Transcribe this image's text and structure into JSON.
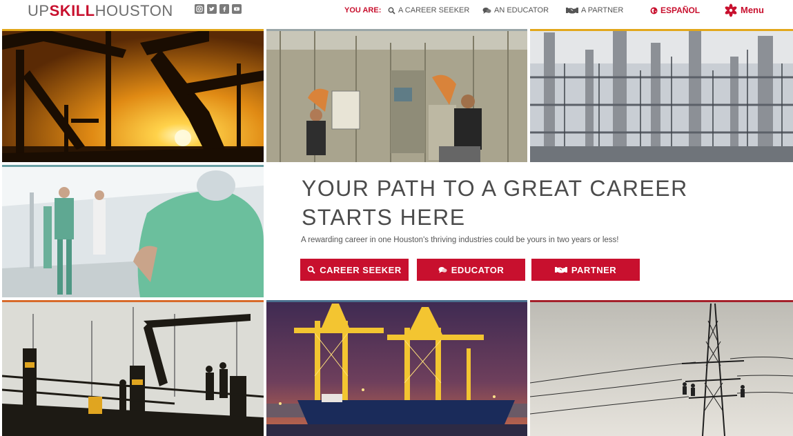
{
  "header": {
    "logo": {
      "part1": "UP",
      "part2": "SKILL",
      "part3": "HOUSTON"
    },
    "social_icons": [
      "instagram-icon",
      "twitter-icon",
      "facebook-icon",
      "youtube-icon"
    ],
    "you_are_label": "YOU ARE:",
    "nav": {
      "career_seeker": "A CAREER SEEKER",
      "educator": "AN EDUCATOR",
      "partner": "A PARTNER",
      "espanol": "ESPAÑOL",
      "menu": "Menu"
    }
  },
  "hero": {
    "title_line1": "YOUR PATH TO A GREAT CAREER",
    "title_line2": "STARTS HERE",
    "subtitle": "A rewarding career in one Houston's thriving industries could be yours in two years or less!",
    "buttons": {
      "career_seeker": "CAREER SEEKER",
      "educator": "EDUCATOR",
      "partner": "PARTNER"
    }
  },
  "colors": {
    "brand_red": "#c8102e",
    "tile_bar_gold": "#e2a71b",
    "tile_bar_teal": "#6a9fa4",
    "tile_bar_orange": "#d86a2a",
    "tile_bar_steel": "#4b6f8e",
    "tile_bar_dark_red": "#a4202a"
  }
}
